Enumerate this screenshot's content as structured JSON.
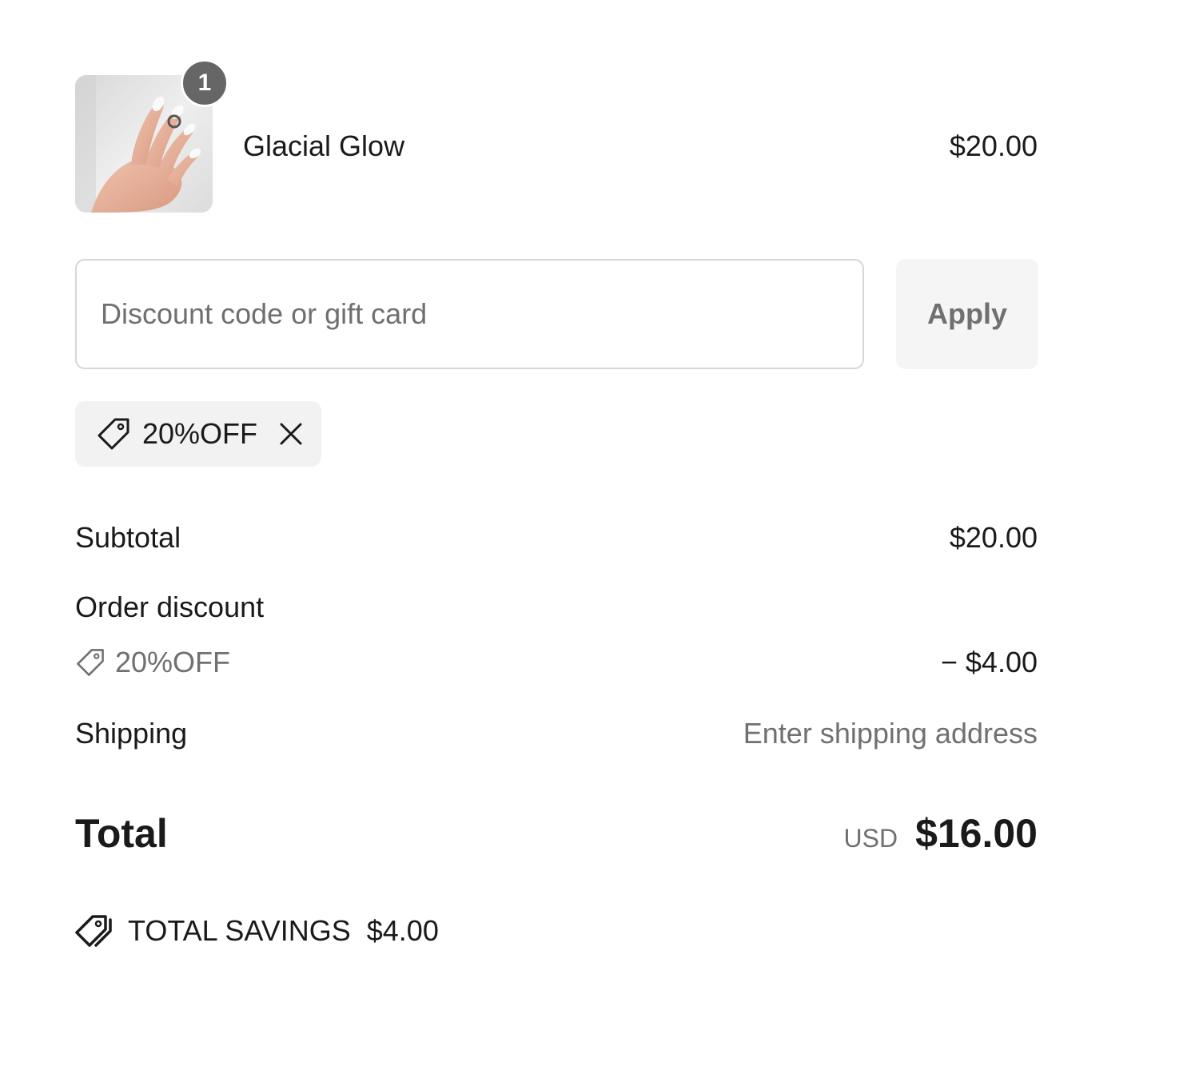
{
  "product": {
    "name": "Glacial Glow",
    "price": "$20.00",
    "quantity": "1",
    "thumbnail_icon": "manicured-hand-photo"
  },
  "discount": {
    "placeholder": "Discount code or gift card",
    "value": "",
    "apply_label": "Apply",
    "applied_code": "20%OFF",
    "tag_icon": "tag-icon",
    "remove_icon": "close-icon"
  },
  "summary": {
    "subtotal_label": "Subtotal",
    "subtotal_value": "$20.00",
    "order_discount_label": "Order discount",
    "order_discount_code": "20%OFF",
    "order_discount_value": "− $4.00",
    "shipping_label": "Shipping",
    "shipping_value": "Enter shipping address",
    "total_label": "Total",
    "total_currency": "USD",
    "total_value": "$16.00",
    "savings_label": "TOTAL SAVINGS",
    "savings_value": "$4.00"
  },
  "colors": {
    "text": "#1a1a1a",
    "muted": "#707070",
    "badge": "#666666",
    "chip_bg": "#f2f2f2",
    "button_bg": "#f5f5f5",
    "border": "#d6d6d6"
  }
}
